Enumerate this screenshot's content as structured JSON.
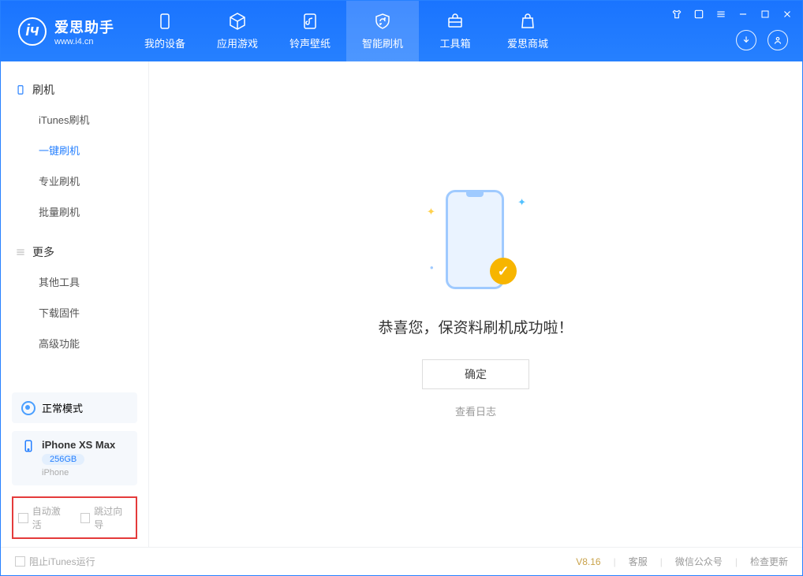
{
  "app": {
    "title": "爱思助手",
    "subtitle": "www.i4.cn"
  },
  "tabs": {
    "device": "我的设备",
    "apps": "应用游戏",
    "ringtone": "铃声壁纸",
    "flash": "智能刷机",
    "toolbox": "工具箱",
    "store": "爱思商城"
  },
  "sidebar": {
    "section_flash": "刷机",
    "items_flash": {
      "itunes": "iTunes刷机",
      "oneclick": "一键刷机",
      "pro": "专业刷机",
      "batch": "批量刷机"
    },
    "section_more": "更多",
    "items_more": {
      "other": "其他工具",
      "firmware": "下载固件",
      "advanced": "高级功能"
    }
  },
  "device": {
    "mode": "正常模式",
    "name": "iPhone XS Max",
    "storage": "256GB",
    "type": "iPhone"
  },
  "options": {
    "auto_activate": "自动激活",
    "skip_guide": "跳过向导"
  },
  "main": {
    "success": "恭喜您，保资料刷机成功啦！",
    "confirm": "确定",
    "view_log": "查看日志"
  },
  "footer": {
    "block_itunes": "阻止iTunes运行",
    "version": "V8.16",
    "support": "客服",
    "wechat": "微信公众号",
    "update": "检查更新"
  }
}
